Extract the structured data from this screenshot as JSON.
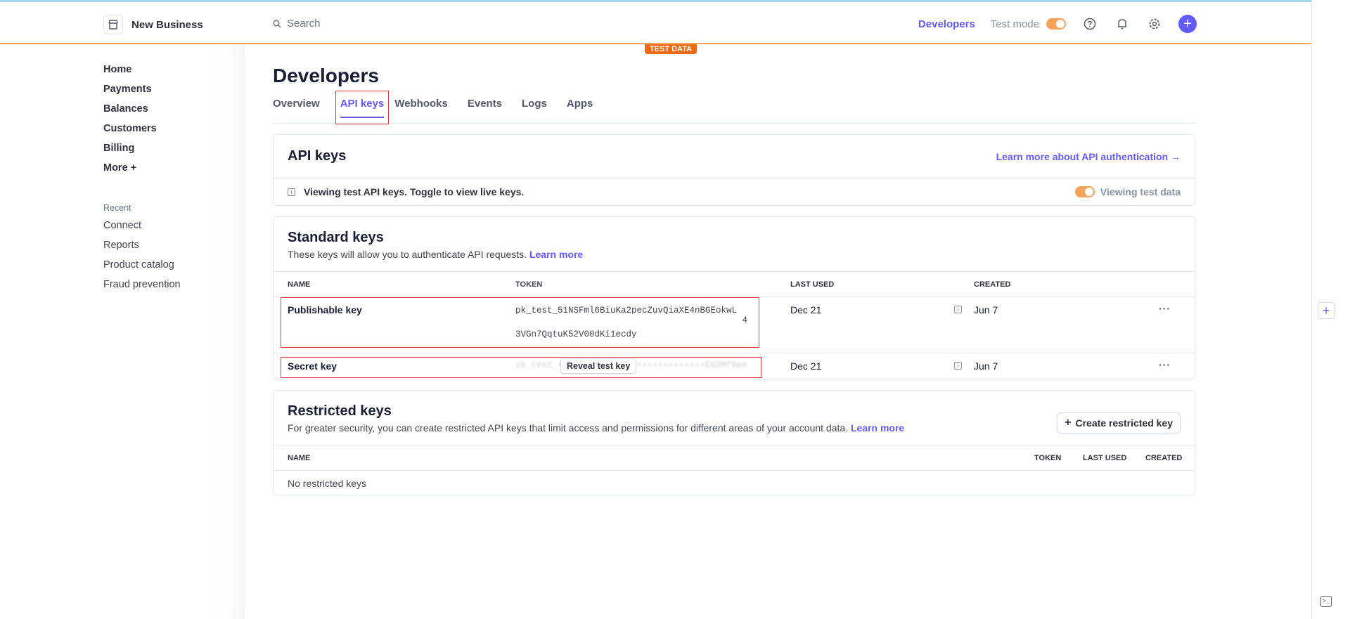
{
  "header": {
    "business_name": "New Business",
    "search_placeholder": "Search",
    "developers_label": "Developers",
    "test_mode_label": "Test mode",
    "test_badge": "TEST DATA"
  },
  "sidebar": {
    "items": [
      {
        "label": "Home"
      },
      {
        "label": "Payments"
      },
      {
        "label": "Balances"
      },
      {
        "label": "Customers"
      },
      {
        "label": "Billing"
      },
      {
        "label": "More +"
      }
    ],
    "recent_title": "Recent",
    "recent": [
      {
        "label": "Connect"
      },
      {
        "label": "Reports"
      },
      {
        "label": "Product catalog"
      },
      {
        "label": "Fraud prevention"
      }
    ]
  },
  "main": {
    "title": "Developers",
    "tabs": [
      {
        "label": "Overview"
      },
      {
        "label": "API keys"
      },
      {
        "label": "Webhooks"
      },
      {
        "label": "Events"
      },
      {
        "label": "Logs"
      },
      {
        "label": "Apps"
      }
    ],
    "api_keys_card": {
      "title": "API keys",
      "learn_link": "Learn more about API authentication →",
      "notice": "Viewing test API keys. Toggle to view live keys.",
      "viewing_label": "Viewing test data"
    },
    "standard_keys": {
      "title": "Standard keys",
      "subtitle": "These keys will allow you to authenticate API requests.",
      "learn_more": "Learn more",
      "columns": {
        "name": "NAME",
        "token": "TOKEN",
        "last_used": "LAST USED",
        "created": "CREATED"
      },
      "rows": [
        {
          "name": "Publishable key",
          "token_line1": "pk_test_51NSFml6BiuKa2pecZuvQiaXE4nBGEokwL",
          "token_line2": "4",
          "token_line3": "3VGn7QqtuK52V00dKi1ecdy",
          "last_used": "Dec 21",
          "created": "Jun 7",
          "more": "···"
        },
        {
          "name": "Secret key",
          "token_masked": "sk_test_••••••••••••••••••••••••••••EG3MfBee",
          "reveal_label": "Reveal test key",
          "last_used": "Dec 21",
          "created": "Jun 7",
          "more": "···"
        }
      ]
    },
    "restricted_keys": {
      "title": "Restricted keys",
      "subtitle": "For greater security, you can create restricted API keys that limit access and permissions for different areas of your account data.",
      "learn_more": "Learn more",
      "create_label": "Create restricted key",
      "columns": {
        "name": "NAME",
        "token": "TOKEN",
        "last_used": "LAST USED",
        "created": "CREATED"
      },
      "empty": "No restricted keys"
    }
  },
  "colors": {
    "accent": "#635bff",
    "test_orange": "#f06a12",
    "highlight": "#e0393e"
  }
}
